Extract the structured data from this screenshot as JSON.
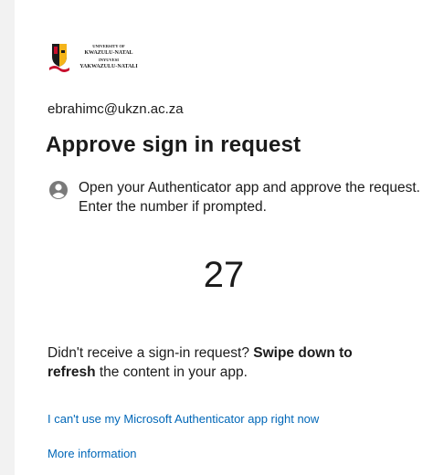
{
  "logo": {
    "line1": "UNIVERSITY OF",
    "line2": "KWAZULU-NATAL",
    "line3": "INYUVESI",
    "line4": "YAKWAZULU-NATALI"
  },
  "account": {
    "email": "ebrahimc@ukzn.ac.za"
  },
  "page": {
    "title": "Approve sign in request",
    "instruction": "Open your Authenticator app and approve the request. Enter the number if prompted.",
    "code": "27"
  },
  "hint": {
    "prefix": "Didn't receive a sign-in request? ",
    "bold1": "Swipe down to",
    "bold2": "refresh",
    "suffix": " the content in your app."
  },
  "links": {
    "cant_use": "I can't use my Microsoft Authenticator app right now",
    "more_info": "More information"
  },
  "colors": {
    "link": "#0067b8",
    "text": "#1b1b1b",
    "icon": "#505050"
  }
}
